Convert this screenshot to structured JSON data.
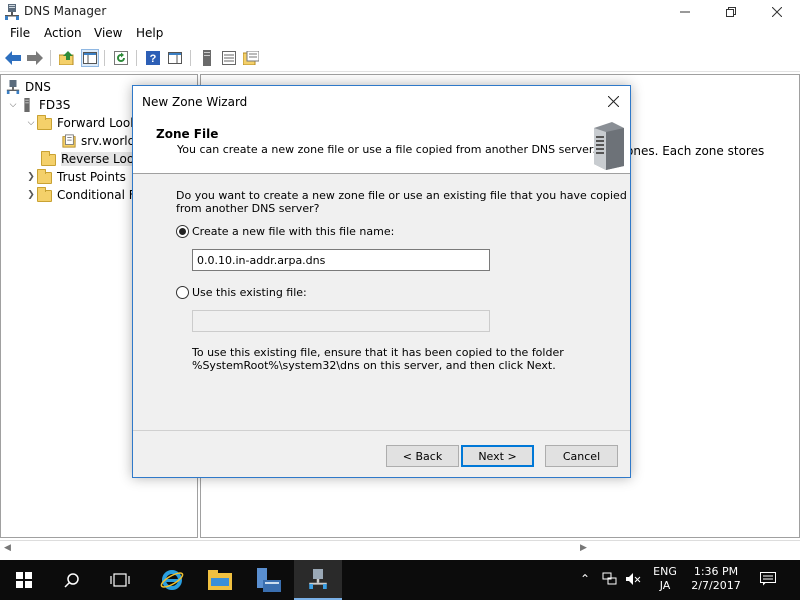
{
  "app": {
    "title": "DNS Manager",
    "menu": [
      "File",
      "Action",
      "View",
      "Help"
    ]
  },
  "tree": {
    "root": "DNS",
    "server": "FD3S",
    "forward": "Forward Look",
    "forward_child": "srv.world",
    "reverse": "Reverse Look",
    "trust": "Trust Points",
    "conditional": "Conditional F"
  },
  "right_pane": {
    "text": "ones. Each zone stores"
  },
  "dialog": {
    "title": "New Zone Wizard",
    "header_title": "Zone File",
    "header_subtitle": "You can create a new zone file or use a file copied from another DNS server.",
    "question_line1": "Do you want to create a new zone file or use an existing file that you have copied",
    "question_line2": "from another DNS server?",
    "option_new_label": "Create a new file with this file name:",
    "new_file_value": "0.0.10.in-addr.arpa.dns",
    "option_existing_label": "Use this existing file:",
    "existing_file_value": "",
    "note_line1": "To use this existing file, ensure that it has been copied to the folder",
    "note_line2": "%SystemRoot%\\system32\\dns on this server, and then click Next.",
    "back_label": "< Back",
    "next_label": "Next >",
    "cancel_label": "Cancel"
  },
  "taskbar": {
    "lang_top": "ENG",
    "lang_bottom": "JA",
    "time": "1:36 PM",
    "date": "2/7/2017"
  },
  "colors": {
    "accent": "#0078d7",
    "dialog_border": "#2f79c9",
    "taskbar": "#0c0c0c"
  }
}
